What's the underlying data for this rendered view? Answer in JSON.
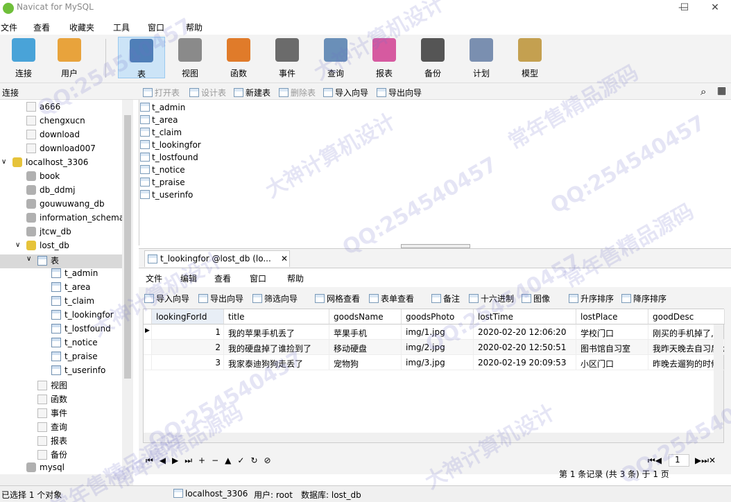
{
  "window": {
    "title": "Navicat for MySQL",
    "min": "—",
    "max": "☐",
    "close": "✕"
  },
  "menu": [
    "文件",
    "查看",
    "收藏夹",
    "工具",
    "窗口",
    "帮助"
  ],
  "toolbar": [
    {
      "label": "连接",
      "icon": "connect-icon",
      "color": "#49a3d8"
    },
    {
      "label": "用户",
      "icon": "user-icon",
      "color": "#e8a33c"
    },
    {
      "label": "表",
      "icon": "table-icon",
      "color": "#4f7fb8"
    },
    {
      "label": "视图",
      "icon": "view-icon",
      "color": "#8a8a8a"
    },
    {
      "label": "函数",
      "icon": "function-icon",
      "color": "#e07b2a"
    },
    {
      "label": "事件",
      "icon": "event-icon",
      "color": "#6b6b6b"
    },
    {
      "label": "查询",
      "icon": "query-icon",
      "color": "#6a8fb8"
    },
    {
      "label": "报表",
      "icon": "report-icon",
      "color": "#d65aa0"
    },
    {
      "label": "备份",
      "icon": "backup-icon",
      "color": "#555555"
    },
    {
      "label": "计划",
      "icon": "schedule-icon",
      "color": "#7a8fb0"
    },
    {
      "label": "模型",
      "icon": "model-icon",
      "color": "#c4a050"
    }
  ],
  "objbar": {
    "section": "连接",
    "open": "打开表",
    "design": "设计表",
    "new": "新建表",
    "delete": "删除表",
    "import": "导入向导",
    "export": "导出向导"
  },
  "tree": [
    {
      "label": "a666",
      "type": "doc"
    },
    {
      "label": "chengxucn",
      "type": "doc"
    },
    {
      "label": "download",
      "type": "doc"
    },
    {
      "label": "download007",
      "type": "doc"
    },
    {
      "label": "localhost_3306",
      "type": "conn"
    },
    {
      "label": "book",
      "type": "db"
    },
    {
      "label": "db_ddmj",
      "type": "db"
    },
    {
      "label": "gouwuwang_db",
      "type": "db"
    },
    {
      "label": "information_schema",
      "type": "db"
    },
    {
      "label": "jtcw_db",
      "type": "db"
    },
    {
      "label": "lost_db",
      "type": "dbo"
    },
    {
      "label": "表",
      "type": "tbl"
    },
    {
      "label": "t_admin",
      "type": "tbl"
    },
    {
      "label": "t_area",
      "type": "tbl"
    },
    {
      "label": "t_claim",
      "type": "tbl"
    },
    {
      "label": "t_lookingfor",
      "type": "tbl"
    },
    {
      "label": "t_lostfound",
      "type": "tbl"
    },
    {
      "label": "t_notice",
      "type": "tbl"
    },
    {
      "label": "t_praise",
      "type": "tbl"
    },
    {
      "label": "t_userinfo",
      "type": "tbl"
    },
    {
      "label": "视图",
      "type": "doc"
    },
    {
      "label": "函数",
      "type": "doc"
    },
    {
      "label": "事件",
      "type": "doc"
    },
    {
      "label": "查询",
      "type": "doc"
    },
    {
      "label": "报表",
      "type": "doc"
    },
    {
      "label": "备份",
      "type": "doc"
    },
    {
      "label": "mysql",
      "type": "db"
    }
  ],
  "tables": [
    "t_admin",
    "t_area",
    "t_claim",
    "t_lookingfor",
    "t_lostfound",
    "t_notice",
    "t_praise",
    "t_userinfo"
  ],
  "tab": {
    "title": "t_lookingfor @lost_db (lo...",
    "close": "✕"
  },
  "tabmenu": [
    "文件",
    "编辑",
    "查看",
    "窗口",
    "帮助"
  ],
  "tabtools": [
    "导入向导",
    "导出向导",
    "筛选向导",
    "网格查看",
    "表单查看",
    "备注",
    "十六进制",
    "图像",
    "升序排序",
    "降序排序"
  ],
  "columns": [
    "lookingForId",
    "title",
    "goodsName",
    "goodsPhoto",
    "lostTime",
    "lostPlace",
    "goodDesc"
  ],
  "rows": [
    [
      "1",
      "我的苹果手机丢了",
      "苹果手机",
      "img/1.jpg",
      "2020-02-20 12:06:20",
      "学校门口",
      "刚买的手机掉了,哪"
    ],
    [
      "2",
      "我的硬盘掉了谁捡到了",
      "移动硬盘",
      "img/2.jpg",
      "2020-02-20 12:50:51",
      "图书馆自习室",
      "我昨天晚去自习后が"
    ],
    [
      "3",
      "我家泰迪狗狗走丢了",
      "宠物狗",
      "img/3.jpg",
      "2020-02-19 20:09:53",
      "小区门口",
      "昨晚去遛狗的时候"
    ]
  ],
  "nav": {
    "page": "1",
    "record": "第 1 条记录 (共 3 条) 于 1 页"
  },
  "status": {
    "selected": "已选择 1 个对象",
    "conn": "localhost_3306",
    "user": "用户: root",
    "db": "数据库: lost_db"
  },
  "watermarks": [
    "QQ:254540457",
    "大神计算机设计",
    "常年售精品源码"
  ]
}
